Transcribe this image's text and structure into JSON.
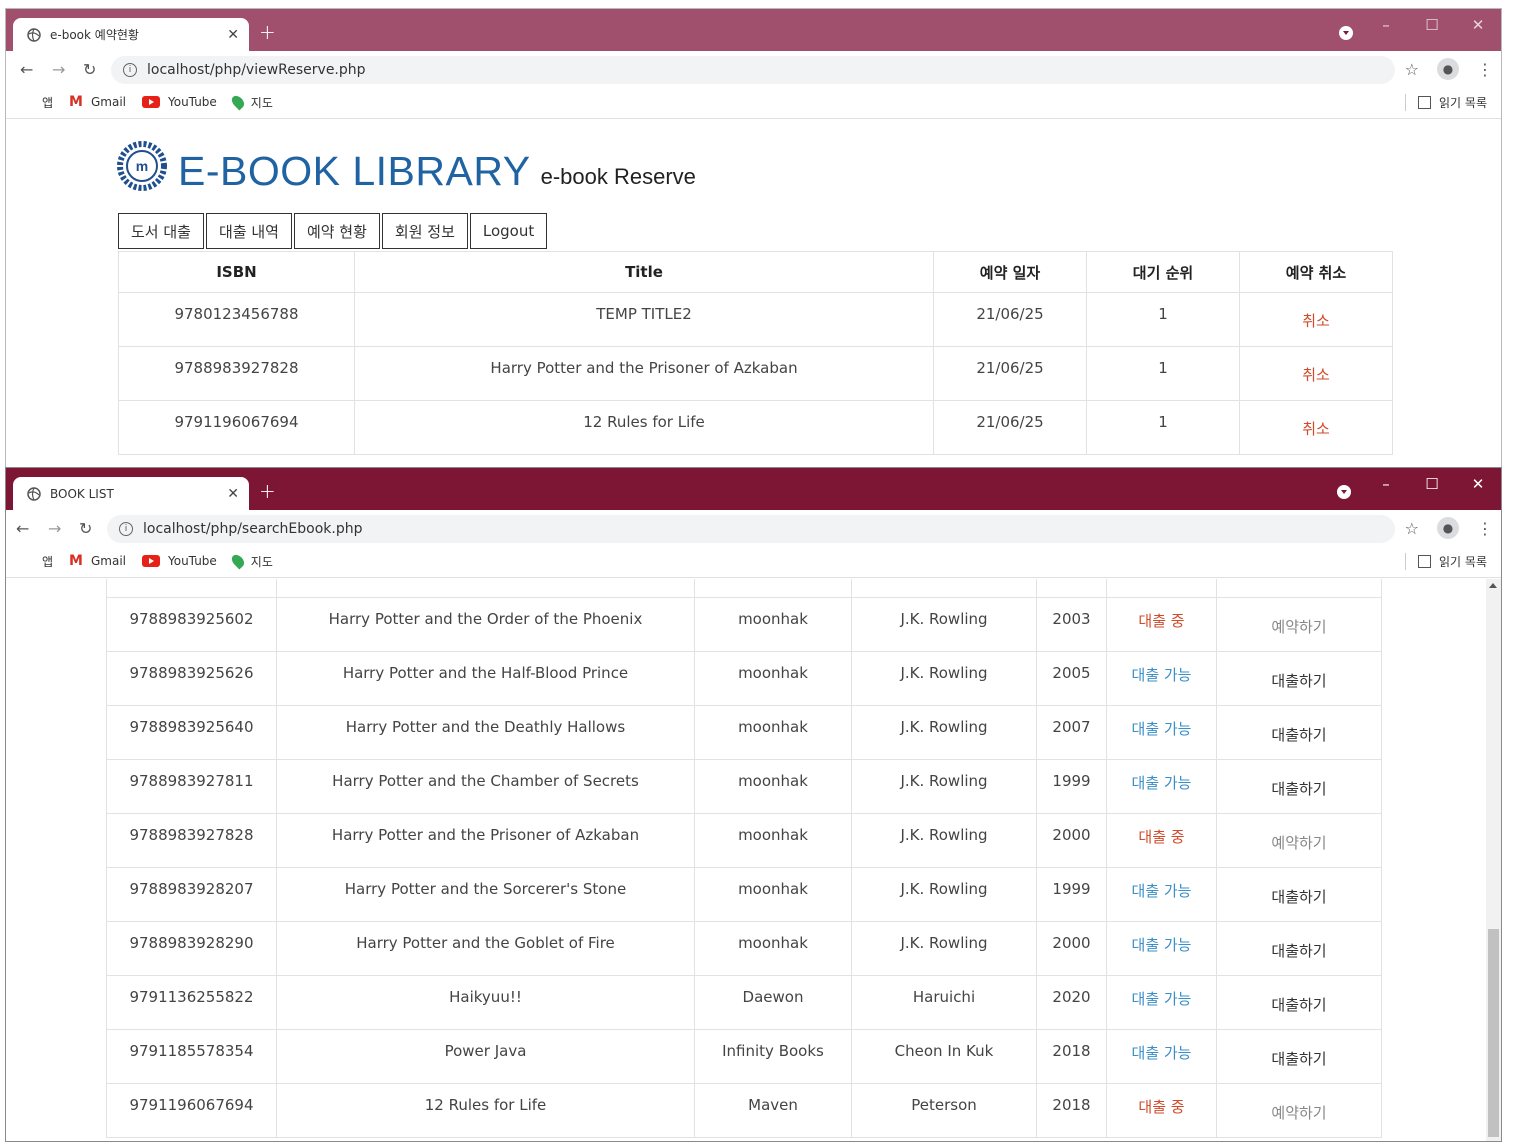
{
  "window1": {
    "tab_title": "e-book 예약현황",
    "url": "localhost/php/viewReserve.php",
    "titlebar_color": "#a0506c",
    "logo_text": "E-BOOK LIBRARY",
    "logo_subtitle": "e-book Reserve",
    "menu": [
      "도서 대출",
      "대출 내역",
      "예약 현황",
      "회원 정보",
      "Logout"
    ],
    "table": {
      "headers": [
        "ISBN",
        "Title",
        "예약 일자",
        "대기 순위",
        "예약 취소"
      ],
      "rows": [
        {
          "isbn": "9780123456788",
          "title": "TEMP TITLE2",
          "date": "21/06/25",
          "rank": "1",
          "cancel": "취소"
        },
        {
          "isbn": "9788983927828",
          "title": "Harry Potter and the Prisoner of Azkaban",
          "date": "21/06/25",
          "rank": "1",
          "cancel": "취소"
        },
        {
          "isbn": "9791196067694",
          "title": "12 Rules for Life",
          "date": "21/06/25",
          "rank": "1",
          "cancel": "취소"
        }
      ]
    }
  },
  "window2": {
    "tab_title": "BOOK LIST",
    "url": "localhost/php/searchEbook.php",
    "titlebar_color": "#7d1535",
    "rows": [
      {
        "isbn": "9788983925602",
        "title": "Harry Potter and the Order of the Phoenix",
        "publisher": "moonhak",
        "author": "J.K. Rowling",
        "year": "2003",
        "status": "대출 중",
        "action": "예약하기"
      },
      {
        "isbn": "9788983925626",
        "title": "Harry Potter and the Half-Blood Prince",
        "publisher": "moonhak",
        "author": "J.K. Rowling",
        "year": "2005",
        "status": "대출 가능",
        "action": "대출하기"
      },
      {
        "isbn": "9788983925640",
        "title": "Harry Potter and the Deathly Hallows",
        "publisher": "moonhak",
        "author": "J.K. Rowling",
        "year": "2007",
        "status": "대출 가능",
        "action": "대출하기"
      },
      {
        "isbn": "9788983927811",
        "title": "Harry Potter and the Chamber of Secrets",
        "publisher": "moonhak",
        "author": "J.K. Rowling",
        "year": "1999",
        "status": "대출 가능",
        "action": "대출하기"
      },
      {
        "isbn": "9788983927828",
        "title": "Harry Potter and the Prisoner of Azkaban",
        "publisher": "moonhak",
        "author": "J.K. Rowling",
        "year": "2000",
        "status": "대출 중",
        "action": "예약하기"
      },
      {
        "isbn": "9788983928207",
        "title": "Harry Potter and the Sorcerer's Stone",
        "publisher": "moonhak",
        "author": "J.K. Rowling",
        "year": "1999",
        "status": "대출 가능",
        "action": "대출하기"
      },
      {
        "isbn": "9788983928290",
        "title": "Harry Potter and the Goblet of Fire",
        "publisher": "moonhak",
        "author": "J.K. Rowling",
        "year": "2000",
        "status": "대출 가능",
        "action": "대출하기"
      },
      {
        "isbn": "9791136255822",
        "title": "Haikyuu!!",
        "publisher": "Daewon",
        "author": "Haruichi",
        "year": "2020",
        "status": "대출 가능",
        "action": "대출하기"
      },
      {
        "isbn": "9791185578354",
        "title": "Power Java",
        "publisher": "Infinity Books",
        "author": "Cheon In Kuk",
        "year": "2018",
        "status": "대출 가능",
        "action": "대출하기"
      },
      {
        "isbn": "9791196067694",
        "title": "12 Rules for Life",
        "publisher": "Maven",
        "author": "Peterson",
        "year": "2018",
        "status": "대출 중",
        "action": "예약하기"
      }
    ]
  },
  "bookmarks": [
    "앱",
    "Gmail",
    "YouTube",
    "지도"
  ],
  "reading_list": "읽기 목록",
  "colors": {
    "status_available": "#3a8fc8",
    "status_on_loan": "#d24a2a",
    "logo_blue": "#1f63a3"
  },
  "icons": [
    "globe-icon",
    "close-icon",
    "new-tab-icon",
    "back-icon",
    "forward-icon",
    "reload-icon",
    "info-icon",
    "star-icon",
    "profile-icon",
    "menu-icon",
    "apps-icon",
    "gmail-icon",
    "youtube-icon",
    "maps-icon",
    "reading-list-icon",
    "library-emblem"
  ]
}
